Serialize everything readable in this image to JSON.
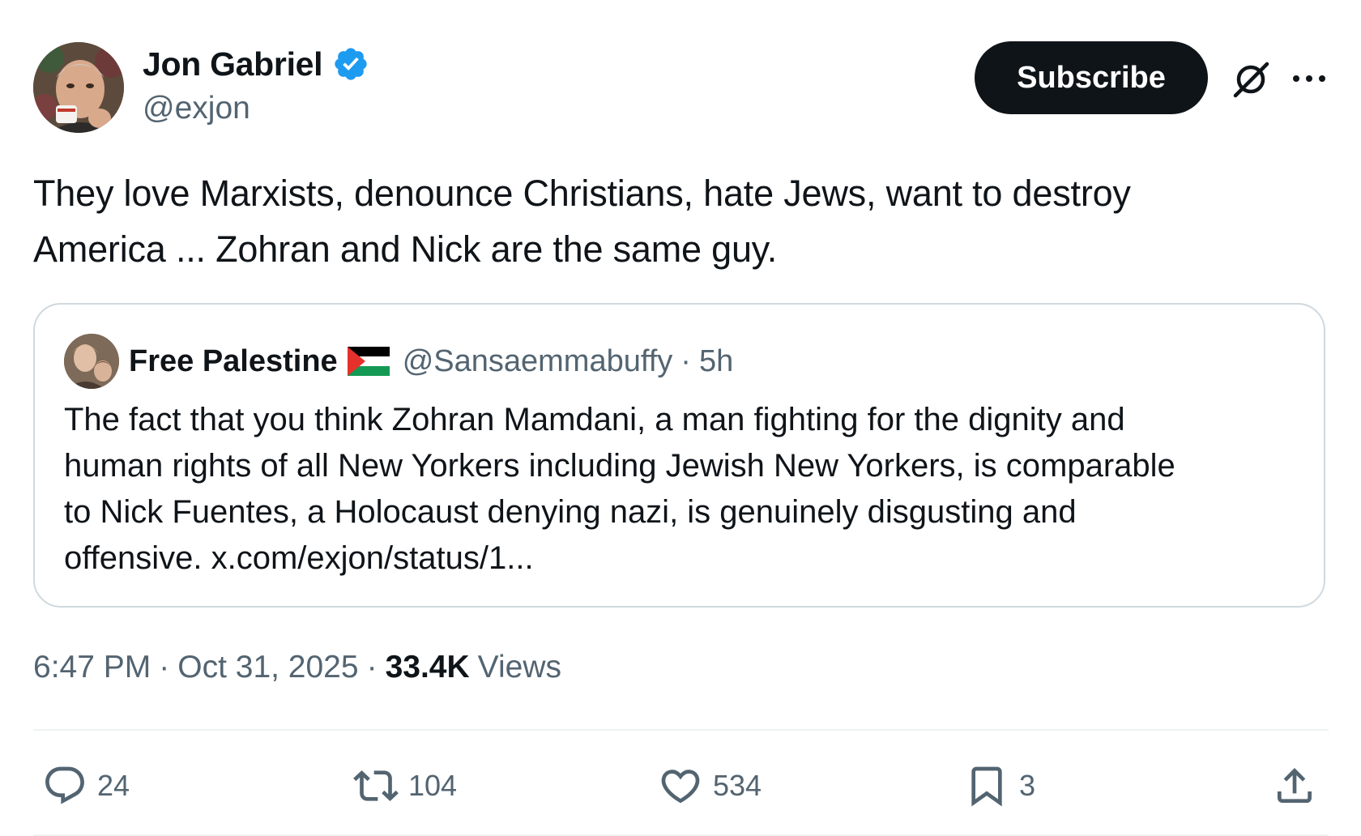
{
  "post": {
    "author": {
      "display_name": "Jon Gabriel",
      "handle": "@exjon",
      "verified": true
    },
    "subscribe_label": "Subscribe",
    "text_line1": "They love Marxists, denounce Christians, hate Jews, want to destroy",
    "text_line2": "America ... Zohran and Nick are the same guy.",
    "quote": {
      "display_name": "Free Palestine",
      "flag": "palestine-flag",
      "handle": "@Sansaemmabuffy",
      "separator": "·",
      "time": "5h",
      "text_line1": "The fact that you think Zohran Mamdani, a man fighting for the dignity and",
      "text_line2": "human rights of all New Yorkers including Jewish New Yorkers, is comparable",
      "text_line3": "to Nick Fuentes, a Holocaust denying nazi, is genuinely disgusting and",
      "text_line4": "offensive. x.com/exjon/status/1..."
    },
    "time": "6:47 PM",
    "date": "Oct 31, 2025",
    "separator": "·",
    "views_count": "33.4K",
    "views_label": "Views"
  },
  "actions": {
    "replies": "24",
    "reposts": "104",
    "likes": "534",
    "bookmarks": "3"
  },
  "colors": {
    "text_primary": "#0f1419",
    "text_secondary": "#536471",
    "verified_blue": "#1d9bf0",
    "border": "#cfd9de",
    "divider": "#eff3f4"
  },
  "icons": {
    "verified": "verified-badge-icon",
    "grok": "grok-icon",
    "more": "more-icon",
    "reply": "reply-icon",
    "repost": "repost-icon",
    "like": "like-icon",
    "bookmark": "bookmark-icon",
    "share": "share-icon"
  }
}
